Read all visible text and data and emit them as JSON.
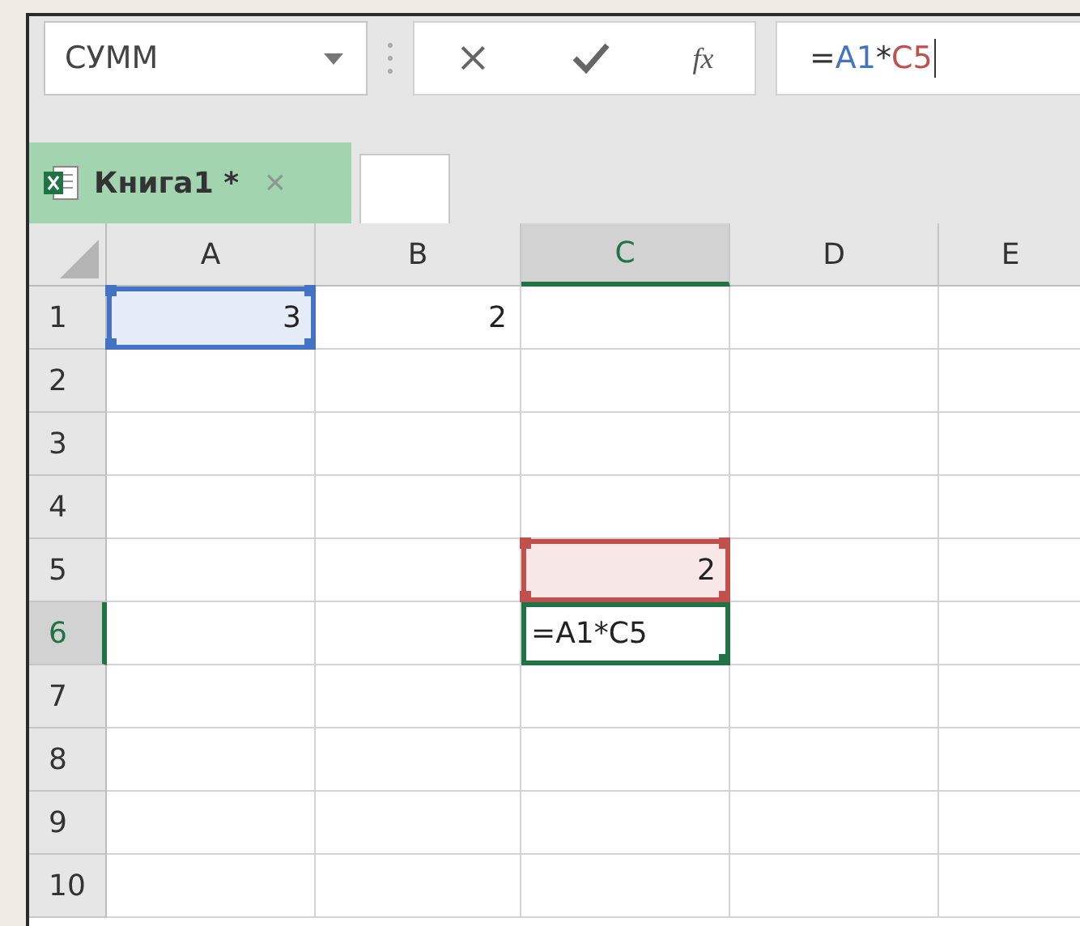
{
  "name_box": {
    "value": "СУММ"
  },
  "formula_bar": {
    "cancel": "×",
    "function_label": "fx",
    "formula": [
      {
        "text": "="
      },
      {
        "text": "A1",
        "color": "#4472c4"
      },
      {
        "text": "*"
      },
      {
        "text": "C5",
        "color": "#c0504d"
      }
    ]
  },
  "tabs": [
    {
      "label": "Книга1 *",
      "close": "×",
      "selected": true
    }
  ],
  "columns": [
    {
      "label": "A",
      "selected": false
    },
    {
      "label": "B",
      "selected": false
    },
    {
      "label": "C",
      "selected": true
    },
    {
      "label": "D",
      "selected": false
    },
    {
      "label": "E",
      "selected": false
    }
  ],
  "rows": [
    {
      "label": "1",
      "selected": false,
      "cells": [
        {
          "value": "3",
          "color": "#4472c4",
          "selected": false
        },
        {
          "value": "2",
          "selected": false
        },
        {
          "selected": false
        },
        {
          "selected": false
        },
        {
          "selected": false
        }
      ]
    },
    {
      "label": "2",
      "selected": false,
      "cells": [
        {
          "selected": false
        },
        {
          "selected": false
        },
        {
          "selected": false
        },
        {
          "selected": false
        },
        {
          "selected": false
        }
      ]
    },
    {
      "label": "3",
      "selected": false,
      "cells": [
        {
          "selected": false
        },
        {
          "selected": false
        },
        {
          "selected": false
        },
        {
          "selected": false
        },
        {
          "selected": false
        }
      ]
    },
    {
      "label": "4",
      "selected": false,
      "cells": [
        {
          "selected": false
        },
        {
          "selected": false
        },
        {
          "selected": false
        },
        {
          "selected": false
        },
        {
          "selected": false
        }
      ]
    },
    {
      "label": "5",
      "selected": false,
      "cells": [
        {
          "selected": false
        },
        {
          "selected": false
        },
        {
          "value": "2",
          "color": "#c0504d",
          "selected": false
        },
        {
          "selected": false
        },
        {
          "selected": false
        }
      ]
    },
    {
      "label": "6",
      "selected": true,
      "cells": [
        {
          "selected": false
        },
        {
          "selected": false
        },
        {
          "value": "=A1*C5",
          "selected": true
        },
        {
          "selected": false
        },
        {
          "selected": false
        }
      ]
    },
    {
      "label": "7",
      "selected": false,
      "cells": [
        {
          "selected": false
        },
        {
          "selected": false
        },
        {
          "selected": false
        },
        {
          "selected": false
        },
        {
          "selected": false
        }
      ]
    },
    {
      "label": "8",
      "selected": false,
      "cells": [
        {
          "selected": false
        },
        {
          "selected": false
        },
        {
          "selected": false
        },
        {
          "selected": false
        },
        {
          "selected": false
        }
      ]
    },
    {
      "label": "9",
      "selected": false,
      "cells": [
        {
          "selected": false
        },
        {
          "selected": false
        },
        {
          "selected": false
        },
        {
          "selected": false
        },
        {
          "selected": false
        }
      ]
    },
    {
      "label": "10",
      "selected": false,
      "cells": [
        {
          "selected": false
        },
        {
          "selected": false
        },
        {
          "selected": false
        },
        {
          "selected": false
        },
        {
          "selected": false
        }
      ]
    }
  ]
}
